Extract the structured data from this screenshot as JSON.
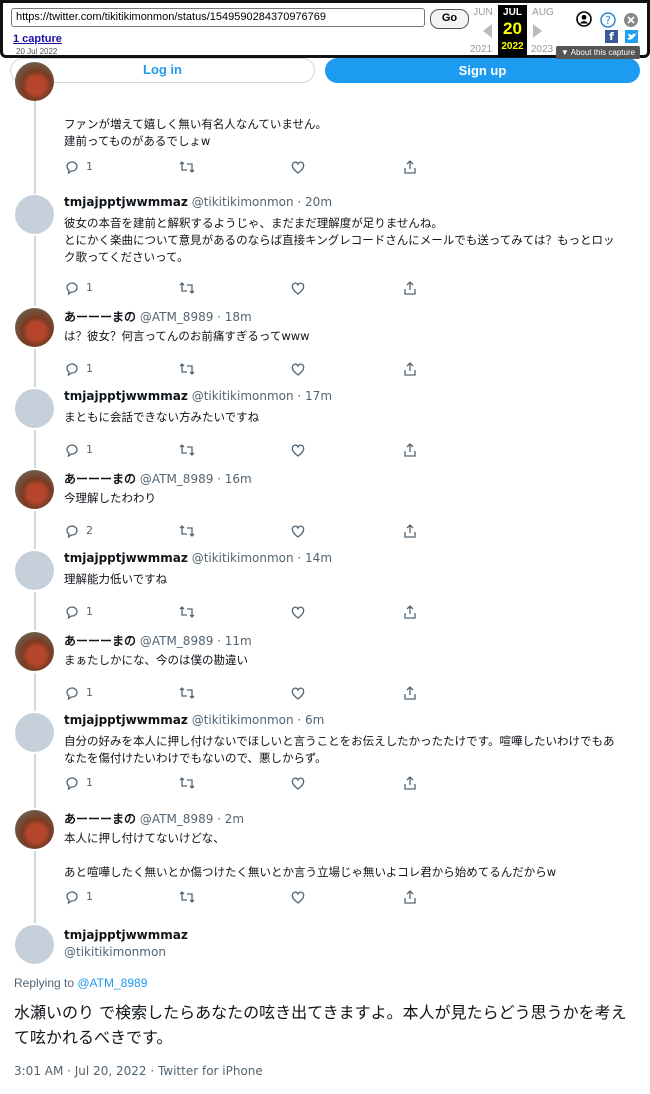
{
  "wayback": {
    "url": "https://twitter.com/tikitikimonmon/status/1549590284370976769",
    "go_label": "Go",
    "captures_label": "1 capture",
    "capture_date": "20 Jul 2022",
    "prev_month": "JUN",
    "cur_month": "JUL",
    "next_month": "AUG",
    "cur_day": "20",
    "prev_year": "2021",
    "cur_year": "2022",
    "next_year": "2023",
    "about_label": "▼ About this capture",
    "colors": {
      "facebook": "#3b5998",
      "twitter": "#1da1f2",
      "help": "#2b8ad8"
    }
  },
  "auth": {
    "login_label": "Log in",
    "signup_label": "Sign up"
  },
  "first_tweet": {
    "lines": [
      "ファンが増えて嬉しく無い有名人なんていません。",
      "建前ってものがあるでしょw"
    ],
    "replies": "1"
  },
  "tweets": [
    {
      "name": "tmjajpptjwwmmaz",
      "handle": "@tikitikimonmon · 20m",
      "lines": [
        "彼女の本音を建前と解釈するようじゃ、まだまだ理解度が足りませんね。",
        "とにかく楽曲について意見があるのならば直接キングレコードさんにメールでも送ってみては？もっとロッ",
        "ク歌ってくださいって。"
      ],
      "replies": "1",
      "avatar": "default"
    },
    {
      "name": "あーーーまの",
      "handle": "@ATM_8989 · 18m",
      "lines": [
        "は？彼女？何言ってんのお前痛すぎるってwww"
      ],
      "replies": "1",
      "avatar": "photo"
    },
    {
      "name": "tmjajpptjwwmmaz",
      "handle": "@tikitikimonmon · 17m",
      "lines": [
        "まともに会話できない方みたいですね"
      ],
      "replies": "1",
      "avatar": "default"
    },
    {
      "name": "あーーーまの",
      "handle": "@ATM_8989 · 16m",
      "lines": [
        "今理解したわわり"
      ],
      "replies": "2",
      "avatar": "photo"
    },
    {
      "name": "tmjajpptjwwmmaz",
      "handle": "@tikitikimonmon · 14m",
      "lines": [
        "理解能力低いですね"
      ],
      "replies": "1",
      "avatar": "default"
    },
    {
      "name": "あーーーまの",
      "handle": "@ATM_8989 · 11m",
      "lines": [
        "まぁたしかにな、今のは僕の勘違い"
      ],
      "replies": "1",
      "avatar": "photo"
    },
    {
      "name": "tmjajpptjwwmmaz",
      "handle": "@tikitikimonmon · 6m",
      "lines": [
        "自分の好みを本人に押し付けないでほしいと言うことをお伝えしたかったたけです。喧嘩したいわけでもあ",
        "なたを傷付けたいわけでもないので、悪しからず。"
      ],
      "replies": "1",
      "avatar": "default"
    },
    {
      "name": "あーーーまの",
      "handle": "@ATM_8989 · 2m",
      "lines": [
        "本人に押し付けてないけどな、",
        "",
        "あと喧嘩したく無いとか傷つけたく無いとか言う立場じゃ無いよコレ君から始めてるんだからw"
      ],
      "replies": "1",
      "avatar": "photo"
    }
  ],
  "main": {
    "name": "tmjajpptjwwmmaz",
    "handle": "@tikitikimonmon",
    "replying_prefix": "Replying to ",
    "replying_to": "@ATM_8989",
    "text": "水瀬いのり で検索したらあなたの呟き出てきますよ。本人が見たらどう思うかを考えて呟かれるべきです。",
    "meta": "3:01 AM · Jul 20, 2022 · Twitter for iPhone"
  }
}
